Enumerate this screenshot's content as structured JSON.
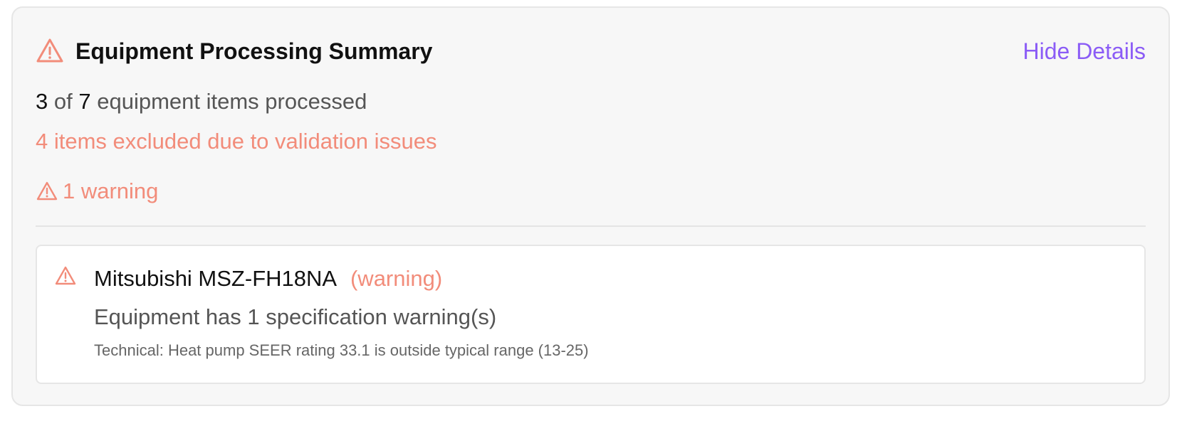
{
  "summary": {
    "title": "Equipment Processing Summary",
    "toggle_label": "Hide Details",
    "processed_count": "3",
    "processed_of": "of",
    "total_count": "7",
    "processed_suffix": "equipment items processed",
    "excluded_text": "4 items excluded due to validation issues",
    "warning_count_text": "1 warning"
  },
  "warnings": [
    {
      "equipment": "Mitsubishi MSZ-FH18NA",
      "severity": "(warning)",
      "message": "Equipment has 1 specification warning(s)",
      "technical": "Technical: Heat pump SEER rating 33.1 is outside typical range (13-25)"
    }
  ],
  "icons": {
    "header": "warning-triangle-icon",
    "warning_count": "warning-triangle-icon",
    "card": "warning-triangle-icon"
  },
  "colors": {
    "accent_link": "#8b5cf6",
    "warning": "#f28c7a",
    "panel_bg": "#f7f7f7",
    "card_bg": "#ffffff",
    "text_primary": "#111111",
    "text_secondary": "#555555"
  }
}
